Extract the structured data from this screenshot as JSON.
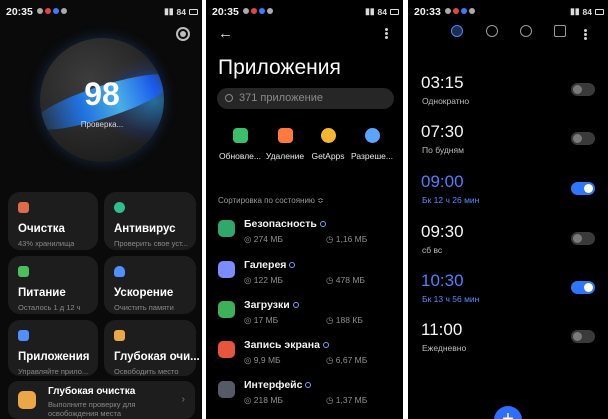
{
  "security": {
    "status_time": "20:35",
    "status_battery": "84",
    "score": "98",
    "score_caption": "Проверка...",
    "tiles": [
      {
        "title": "Очистка",
        "subtitle": "43% хранилища",
        "icon_color": "#e06a4c"
      },
      {
        "title": "Антивирус",
        "subtitle": "Проверить свое уст...",
        "icon_color": "#2fbf8f"
      },
      {
        "title": "Питание",
        "subtitle": "Осталось 1 д 12 ч",
        "icon_color": "#4cbf5c"
      },
      {
        "title": "Ускорение",
        "subtitle": "Очистить памяти",
        "icon_color": "#4f8fff"
      },
      {
        "title": "Приложения",
        "subtitle": "Управляйте прило...",
        "icon_color": "#4f8fff"
      },
      {
        "title": "Глубокая очи...",
        "subtitle": "Освободить место",
        "icon_color": "#e9a845"
      }
    ],
    "wide_card": {
      "title": "Глубокая очистка",
      "subtitle": "Выполните проверку для освобождения места",
      "icon_color": "#e9a845"
    }
  },
  "apps": {
    "status_time": "20:35",
    "status_battery": "84",
    "title": "Приложения",
    "search_placeholder": "371 приложение",
    "actions": [
      {
        "label": "Обновле...",
        "icon_color": "#3bbf6b"
      },
      {
        "label": "Удаление",
        "icon_color": "#ff7a3c"
      },
      {
        "label": "GetApps",
        "icon_color": "#f5b731"
      },
      {
        "label": "Разреше...",
        "icon_color": "#5aa6ff"
      }
    ],
    "sort_label": "Сортировка по состоянию ≎",
    "list": [
      {
        "name": "Безопасность",
        "size_app": "274 МБ",
        "size_data": "1,16 МБ",
        "icon_color": "#2fa86c"
      },
      {
        "name": "Галерея",
        "size_app": "122 МБ",
        "size_data": "478 МБ",
        "icon_color": "#7b8cff"
      },
      {
        "name": "Загрузки",
        "size_app": "17 МБ",
        "size_data": "188 КБ",
        "icon_color": "#3db05a"
      },
      {
        "name": "Запись экрана",
        "size_app": "9,9 МБ",
        "size_data": "6,67 МБ",
        "icon_color": "#e8543c"
      },
      {
        "name": "Интерфейс",
        "size_app": "218 МБ",
        "size_data": "1,37 МБ",
        "icon_color": "#555a66"
      }
    ]
  },
  "clock": {
    "status_time": "20:33",
    "status_battery": "84",
    "tabs": [
      "alarm-icon",
      "clock-icon",
      "stopwatch-icon",
      "timer-icon"
    ],
    "alarms": [
      {
        "time": "03:15",
        "label": "Однократно",
        "enabled": false
      },
      {
        "time": "07:30",
        "label": "По будням",
        "enabled": false
      },
      {
        "time": "09:00",
        "label": "Бк 12 ч 26 мин",
        "enabled": true
      },
      {
        "time": "09:30",
        "label": "сб вс",
        "enabled": false
      },
      {
        "time": "10:30",
        "label": "Бк 13 ч 56 мин",
        "enabled": true
      },
      {
        "time": "11:00",
        "label": "Ежедневно",
        "enabled": false
      }
    ],
    "fab_label": "+"
  }
}
